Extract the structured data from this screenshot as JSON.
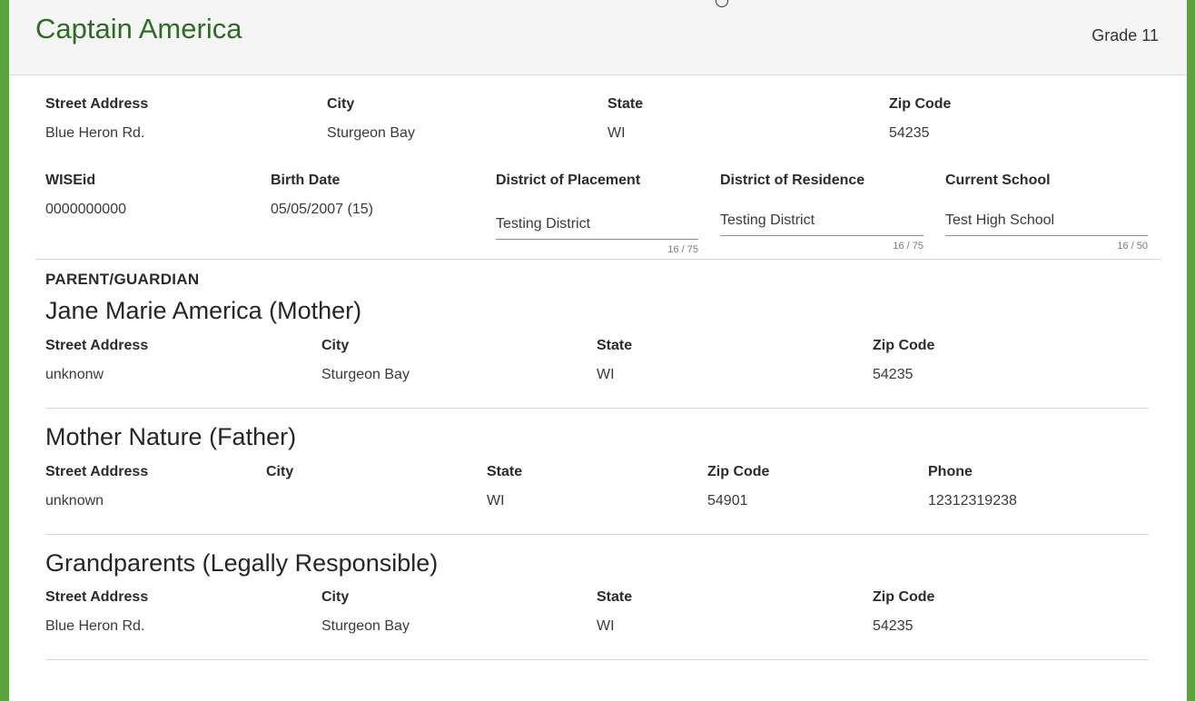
{
  "student": {
    "name": "Captain America",
    "grade": "Grade 11"
  },
  "address": {
    "street_label": "Street Address",
    "street": "Blue Heron Rd.",
    "city_label": "City",
    "city": "Sturgeon Bay",
    "state_label": "State",
    "state": "WI",
    "zip_label": "Zip Code",
    "zip": "54235"
  },
  "info": {
    "wiseid_label": "WISEid",
    "wiseid": "0000000000",
    "birth_label": "Birth Date",
    "birth": "05/05/2007 (15)",
    "placement_label": "District of Placement",
    "placement": "Testing District",
    "placement_count": "16 / 75",
    "residence_label": "District of Residence",
    "residence": "Testing District",
    "residence_count": "16 / 75",
    "school_label": "Current School",
    "school": "Test High School",
    "school_count": "16 / 50"
  },
  "guardians_title": "PARENT/GUARDIAN",
  "guardians": [
    {
      "name": "Jane Marie America (Mother)",
      "street_label": "Street Address",
      "street": "unknonw",
      "city_label": "City",
      "city": "Sturgeon Bay",
      "state_label": "State",
      "state": "WI",
      "zip_label": "Zip Code",
      "zip": "54235"
    },
    {
      "name": "Mother Nature (Father)",
      "street_label": "Street Address",
      "street": "unknown",
      "city_label": "City",
      "city": "",
      "state_label": "State",
      "state": "WI",
      "zip_label": "Zip Code",
      "zip": "54901",
      "phone_label": "Phone",
      "phone": "12312319238"
    },
    {
      "name": "Grandparents (Legally Responsible)",
      "street_label": "Street Address",
      "street": "Blue Heron Rd.",
      "city_label": "City",
      "city": "Sturgeon Bay",
      "state_label": "State",
      "state": "WI",
      "zip_label": "Zip Code",
      "zip": "54235"
    }
  ]
}
